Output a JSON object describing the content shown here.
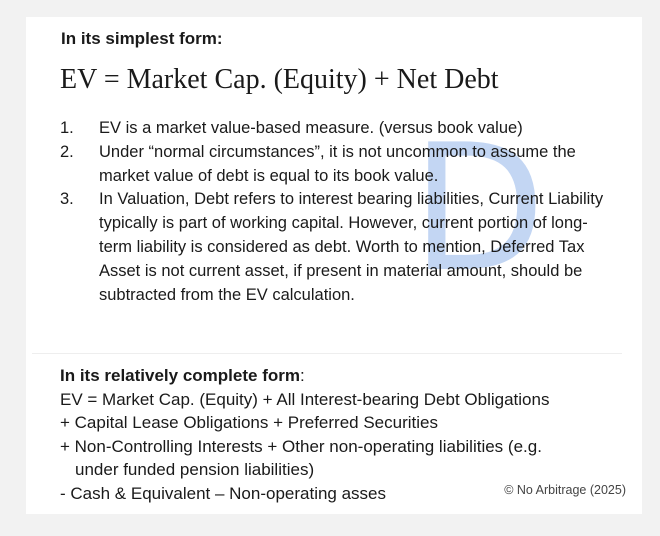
{
  "simplest": {
    "heading": "In its simplest form:",
    "formula": "EV = Market Cap. (Equity) + Net Debt",
    "items": [
      {
        "num": "1.",
        "text": "EV is a market value-based measure. (versus book value)"
      },
      {
        "num": "2.",
        "text": "Under “normal circumstances”, it is not uncommon to assume the market value of debt is equal to its book value."
      },
      {
        "num": "3.",
        "text": "In Valuation, Debt refers to interest bearing liabilities, Current Liability typically is part of working capital. However, current portion of long-term liability is considered as debt. Worth to mention, Deferred Tax Asset is not current asset, if present in material amount, should be subtracted from the EV calculation."
      }
    ]
  },
  "complete": {
    "heading": "In its relatively complete form",
    "heading_suffix": ":",
    "lines": [
      "EV = Market Cap. (Equity) + All Interest-bearing Debt Obligations",
      "+ Capital Lease Obligations + Preferred Securities",
      "+ Non-Controlling Interests + Other non-operating liabilities (e.g.",
      "under funded pension liabilities)",
      "- Cash & Equivalent – Non-operating asses"
    ]
  },
  "watermark": "D",
  "copyright": "© No Arbitrage (2025)",
  "colors": {
    "watermark": "#b9cff2",
    "text": "#1a1a1a",
    "background": "#f2f2f2",
    "card": "#ffffff"
  }
}
